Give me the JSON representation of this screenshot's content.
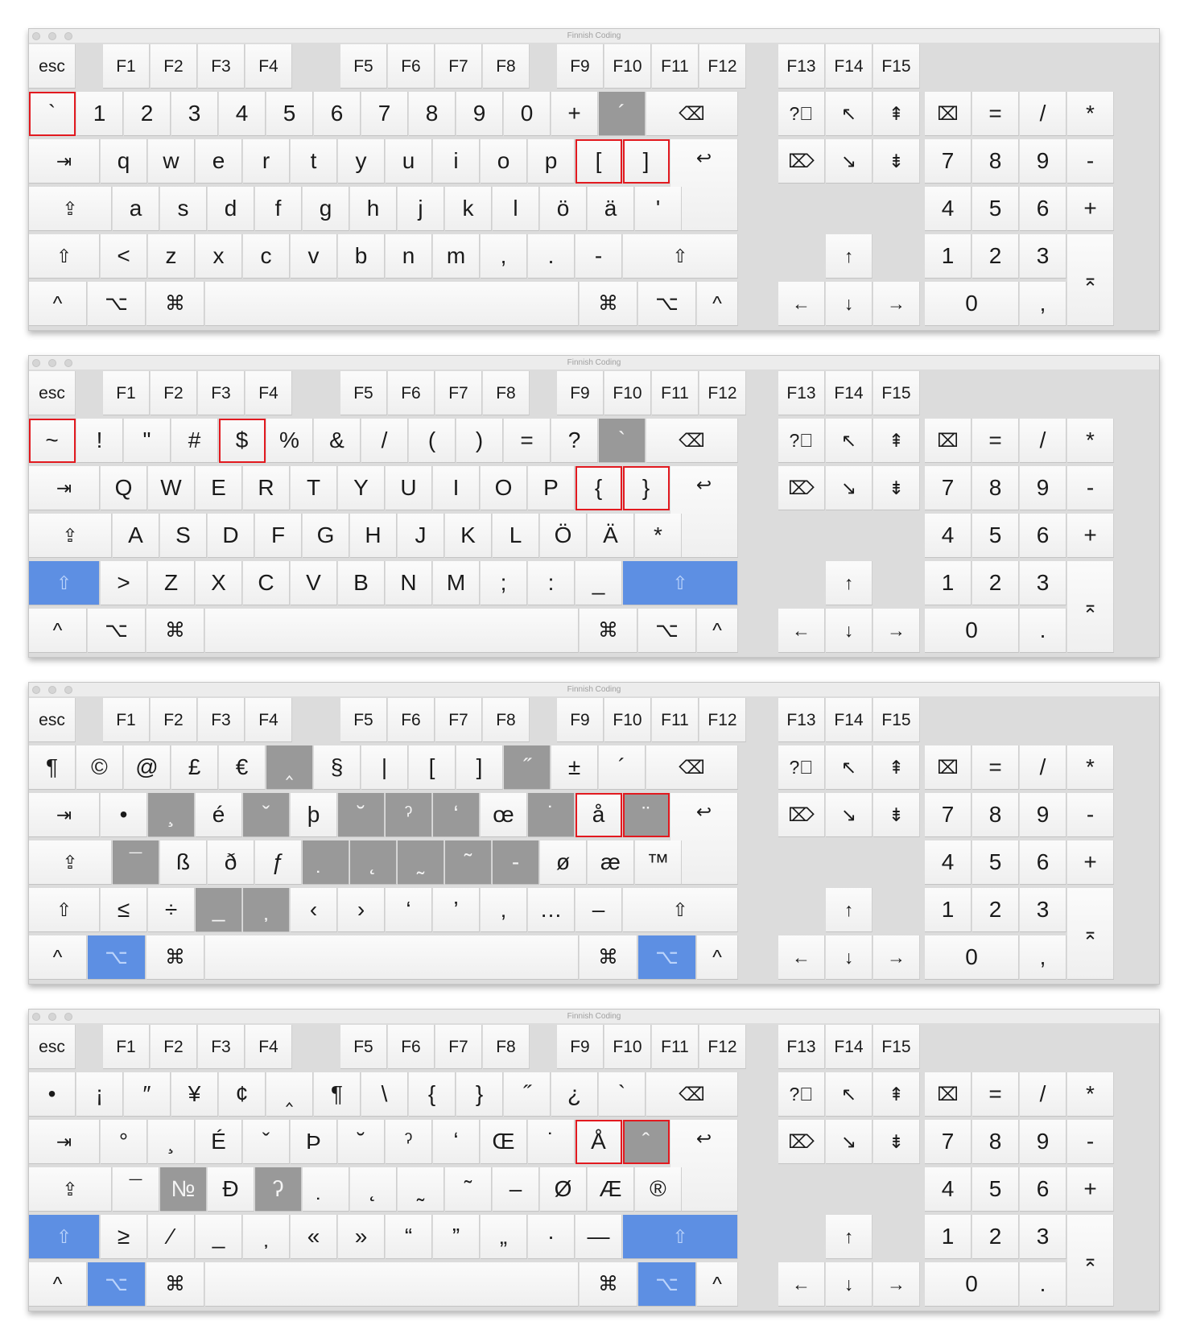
{
  "window_title": "Finnish Coding",
  "colors": {
    "dead_key": "#999999",
    "active_modifier": "#5d8fe3",
    "highlight": "#e2191f"
  },
  "labels": {
    "esc": "esc",
    "f": [
      "F1",
      "F2",
      "F3",
      "F4",
      "F5",
      "F6",
      "F7",
      "F8",
      "F9",
      "F10",
      "F11",
      "F12",
      "F13",
      "F14",
      "F15"
    ],
    "backspace": "⌫",
    "tab": "⇥",
    "enter": "↩",
    "caps": "⇪",
    "shift": "⇧",
    "ctrl": "^",
    "opt": "⌥",
    "cmd": "⌘",
    "help": "?⃝",
    "home": "↖",
    "pgup": "⇞",
    "fdel": "⌦",
    "end": "↘",
    "pgdn": "⇟",
    "up": "↑",
    "left": "←",
    "down": "↓",
    "right": "→",
    "clear": "⌧",
    "np_eq": "=",
    "np_div": "/",
    "np_mul": "*",
    "np_7": "7",
    "np_8": "8",
    "np_9": "9",
    "np_minus": "-",
    "np_4": "4",
    "np_5": "5",
    "np_6": "6",
    "np_plus": "+",
    "np_1": "1",
    "np_2": "2",
    "np_3": "3",
    "np_enter": "⌅",
    "np_0": "0"
  },
  "layers": [
    {
      "name": "Normal",
      "numrow": [
        "`",
        "1",
        "2",
        "3",
        "4",
        "5",
        "6",
        "7",
        "8",
        "9",
        "0",
        "+",
        "´"
      ],
      "qrow": [
        "q",
        "w",
        "e",
        "r",
        "t",
        "y",
        "u",
        "i",
        "o",
        "p",
        "[",
        "]"
      ],
      "arow": [
        "a",
        "s",
        "d",
        "f",
        "g",
        "h",
        "j",
        "k",
        "l",
        "ö",
        "ä",
        "'"
      ],
      "zrow": [
        "<",
        "z",
        "x",
        "c",
        "v",
        "b",
        "n",
        "m",
        ",",
        ".",
        "-"
      ],
      "np_dec": ",",
      "dead": [
        "num12"
      ],
      "highlight": [
        "num0",
        "q10",
        "q11"
      ],
      "active_modifiers": []
    },
    {
      "name": "Shift",
      "numrow": [
        "~",
        "!",
        "\"",
        "#",
        "$",
        "%",
        "&",
        "/",
        "(",
        ")",
        "=",
        "?",
        "`"
      ],
      "qrow": [
        "Q",
        "W",
        "E",
        "R",
        "T",
        "Y",
        "U",
        "I",
        "O",
        "P",
        "{",
        "}"
      ],
      "arow": [
        "A",
        "S",
        "D",
        "F",
        "G",
        "H",
        "J",
        "K",
        "L",
        "Ö",
        "Ä",
        "*"
      ],
      "zrow": [
        ">",
        "Z",
        "X",
        "C",
        "V",
        "B",
        "N",
        "M",
        ";",
        ":",
        "_"
      ],
      "np_dec": ".",
      "dead": [
        "num12"
      ],
      "highlight": [
        "num0",
        "num4",
        "q10",
        "q11"
      ],
      "active_modifiers": [
        "shift"
      ]
    },
    {
      "name": "Option",
      "numrow": [
        "¶",
        "©",
        "@",
        "£",
        "€",
        "‸",
        "§",
        "|",
        "[",
        "]",
        "˝",
        "±",
        "´"
      ],
      "qrow": [
        "•",
        "¸",
        "é",
        "ˇ",
        "þ",
        "˘",
        "ˀ",
        "ʻ",
        "œ",
        "˙",
        "å",
        "¨"
      ],
      "arow": [
        "¯",
        "ß",
        "ð",
        "ƒ",
        "̣",
        "˛",
        "̰",
        "˜",
        "-",
        "ø",
        "æ",
        "™"
      ],
      "zrow": [
        "≤",
        "÷",
        "̲",
        "̦",
        "‹",
        "›",
        "‘",
        "’",
        "‚",
        "…",
        "–"
      ],
      "np_dec": ",",
      "dead": [
        "num5",
        "num10",
        "q1",
        "q3",
        "q5",
        "q6",
        "q7",
        "q9",
        "q11",
        "a0",
        "a4",
        "a5",
        "a6",
        "a7",
        "a8",
        "z2",
        "z3"
      ],
      "highlight": [
        "q10",
        "q11"
      ],
      "active_modifiers": [
        "option"
      ]
    },
    {
      "name": "Shift-Option",
      "numrow": [
        "•",
        "¡",
        "″",
        "¥",
        "¢",
        "‸",
        "¶",
        "\\",
        "{",
        "}",
        "˝",
        "¿",
        "`"
      ],
      "qrow": [
        "°",
        "¸",
        "É",
        "ˇ",
        "Þ",
        "˘",
        "ˀ",
        "ʻ",
        "Œ",
        "˙",
        "Å",
        "ˆ"
      ],
      "arow": [
        "¯",
        "№",
        "Đ",
        "ʔ",
        "̣",
        "˛",
        "̰",
        "˜",
        "–",
        "Ø",
        "Æ",
        "®"
      ],
      "zrow": [
        "≥",
        "⁄",
        "̲",
        "̦",
        "«",
        "»",
        "“",
        "”",
        "„",
        "·",
        "—"
      ],
      "np_dec": ".",
      "dead": [
        "q11",
        "a1",
        "a3"
      ],
      "highlight": [
        "q10",
        "q11"
      ],
      "active_modifiers": [
        "shift",
        "option"
      ]
    }
  ]
}
